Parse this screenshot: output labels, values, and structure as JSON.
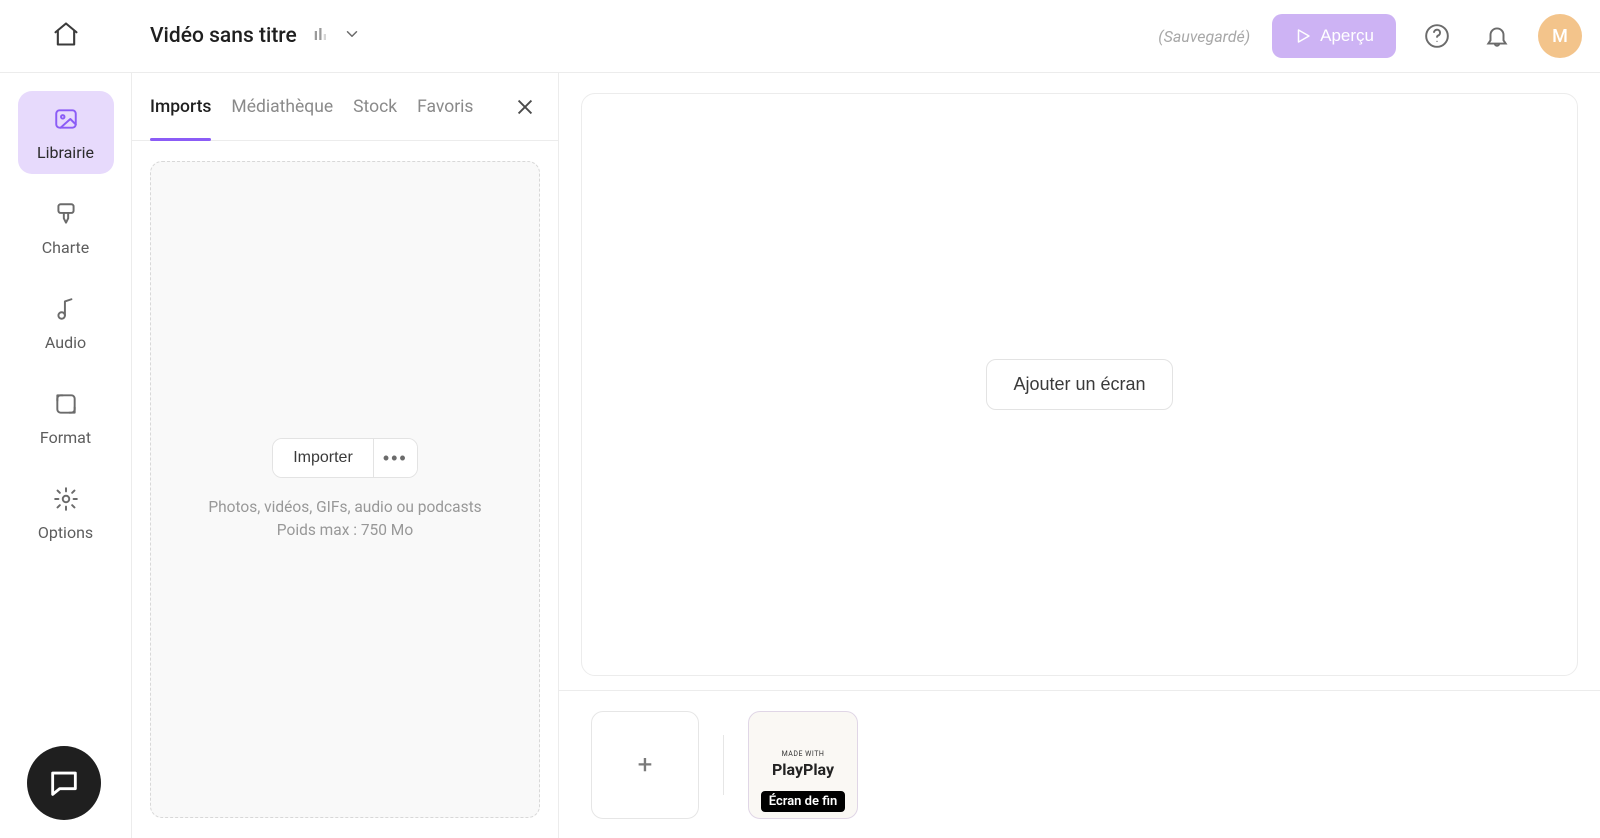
{
  "header": {
    "project_title": "Vidéo sans titre",
    "saved_label": "(Sauvegardé)",
    "preview_label": "Aperçu",
    "avatar_initial": "M"
  },
  "rail": {
    "items": [
      {
        "label": "Librairie",
        "icon": "image-icon",
        "active": true
      },
      {
        "label": "Charte",
        "icon": "brush-icon",
        "active": false
      },
      {
        "label": "Audio",
        "icon": "music-icon",
        "active": false
      },
      {
        "label": "Format",
        "icon": "crop-icon",
        "active": false
      },
      {
        "label": "Options",
        "icon": "gear-icon",
        "active": false
      }
    ]
  },
  "panel": {
    "tabs": [
      {
        "label": "Imports",
        "active": true
      },
      {
        "label": "Médiathèque",
        "active": false
      },
      {
        "label": "Stock",
        "active": false
      },
      {
        "label": "Favoris",
        "active": false
      }
    ],
    "import_button": "Importer",
    "drop_hint_line1": "Photos, vidéos, GIFs, audio ou podcasts",
    "drop_hint_line2": "Poids max : 750 Mo"
  },
  "canvas": {
    "add_screen_label": "Ajouter un écran"
  },
  "timeline": {
    "end_slide": {
      "made_with": "MADE WITH",
      "brand": "PlayPlay",
      "label": "Écran de fin"
    }
  }
}
